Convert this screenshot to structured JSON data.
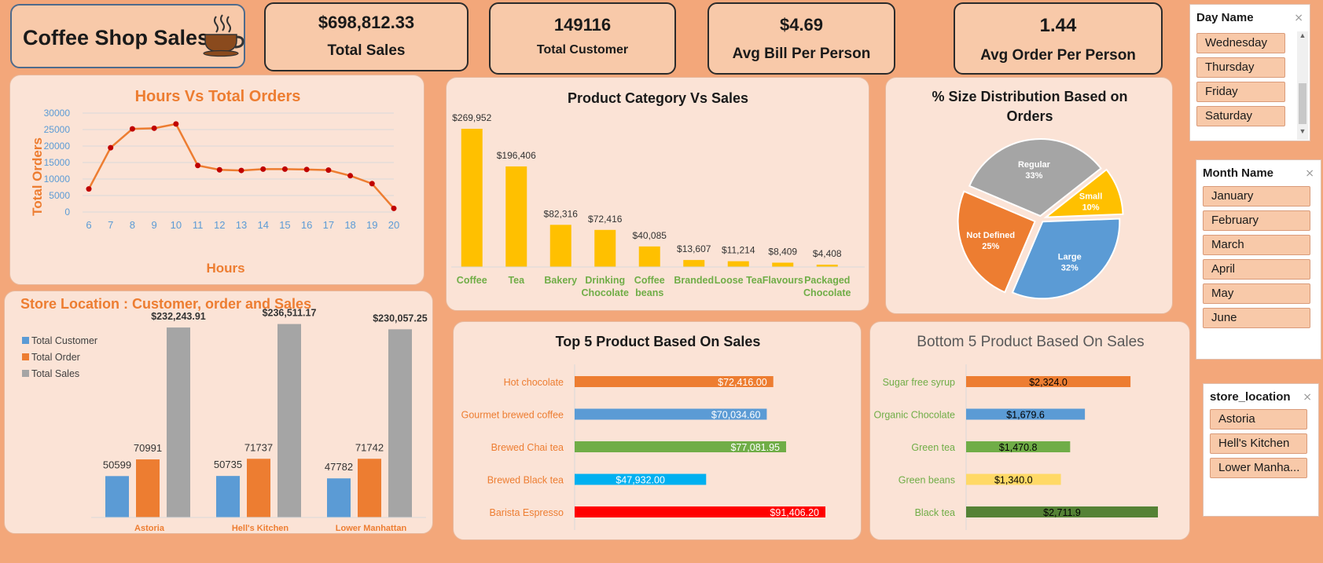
{
  "header": {
    "title": "Coffee Shop Sales",
    "icon": "coffee-cup-icon"
  },
  "kpis": {
    "total_sales": {
      "value": "$698,812.33",
      "label": "Total Sales"
    },
    "total_customer": {
      "value": "149116",
      "label": "Total Customer"
    },
    "avg_bill": {
      "value": "$4.69",
      "label": "Avg Bill Per Person"
    },
    "avg_order": {
      "value": "1.44",
      "label": "Avg Order Per Person"
    }
  },
  "slicers": {
    "day": {
      "header": "Day Name",
      "items": [
        "Wednesday",
        "Thursday",
        "Friday",
        "Saturday"
      ]
    },
    "month": {
      "header": "Month Name",
      "items": [
        "January",
        "February",
        "March",
        "April",
        "May",
        "June"
      ]
    },
    "store": {
      "header": "store_location",
      "items": [
        "Astoria",
        "Hell's Kitchen",
        "Lower Manha..."
      ]
    }
  },
  "chart_data": [
    {
      "id": "hours",
      "type": "line",
      "title": "Hours Vs Total Orders",
      "xlabel": "Hours",
      "ylabel": "Total Orders",
      "x": [
        6,
        7,
        8,
        9,
        10,
        11,
        12,
        13,
        14,
        15,
        16,
        17,
        18,
        19,
        20
      ],
      "y": [
        7000,
        19500,
        25200,
        25400,
        26700,
        14100,
        12800,
        12600,
        13000,
        13000,
        12900,
        12700,
        11000,
        8600,
        1100
      ],
      "ylim": [
        0,
        30000
      ],
      "yticks": [
        0,
        5000,
        10000,
        15000,
        20000,
        25000,
        30000
      ],
      "grid": true,
      "line_color": "#ed7d31",
      "marker_color": "#c00000"
    },
    {
      "id": "category",
      "type": "bar",
      "title": "Product Category Vs Sales",
      "categories": [
        "Coffee",
        "Tea",
        "Bakery",
        "Drinking Chocolate",
        "Coffee beans",
        "Branded",
        "Loose Tea",
        "Flavours",
        "Packaged Chocolate"
      ],
      "values": [
        269952,
        196406,
        82316,
        72416,
        40085,
        13607,
        11214,
        8409,
        4408
      ],
      "labels": [
        "$269,952",
        "$196,406",
        "$82,316",
        "$72,416",
        "$40,085",
        "$13,607",
        "$11,214",
        "$8,409",
        "$4,408"
      ],
      "color": "#ffc000"
    },
    {
      "id": "size",
      "type": "pie",
      "title": "% Size Distribution Based on Orders",
      "slices": [
        {
          "name": "Regular",
          "value": 33,
          "label": "33%",
          "color": "#a5a5a5"
        },
        {
          "name": "Small",
          "value": 10,
          "label": "10%",
          "color": "#ffc000"
        },
        {
          "name": "Large",
          "value": 32,
          "label": "32%",
          "color": "#5b9bd5"
        },
        {
          "name": "Not Defined",
          "value": 25,
          "label": "25%",
          "color": "#ed7d31"
        }
      ]
    },
    {
      "id": "store",
      "type": "bar",
      "title": "Store Location : Customer, order and Sales",
      "categories": [
        "Astoria",
        "Hell's Kitchen",
        "Lower Manhattan"
      ],
      "series": [
        {
          "name": "Total Customer",
          "values": [
            50599,
            50735,
            47782
          ],
          "labels": [
            "50599",
            "50735",
            "47782"
          ],
          "color": "#5b9bd5"
        },
        {
          "name": "Total Order",
          "values": [
            70991,
            71737,
            71742
          ],
          "labels": [
            "70991",
            "71737",
            "71742"
          ],
          "color": "#ed7d31"
        },
        {
          "name": "Total Sales",
          "values": [
            232243.91,
            236511.17,
            230057.25
          ],
          "labels": [
            "$232,243.91",
            "$236,511.17",
            "$230,057.25"
          ],
          "color": "#a5a5a5"
        }
      ],
      "legend": "left"
    },
    {
      "id": "top5",
      "type": "bar",
      "orientation": "horizontal",
      "title": "Top 5 Product Based On Sales",
      "categories": [
        "Hot chocolate",
        "Gourmet brewed coffee",
        "Brewed Chai tea",
        "Brewed Black tea",
        "Barista Espresso"
      ],
      "values": [
        72416.0,
        70034.6,
        77081.95,
        47932.0,
        91406.2
      ],
      "labels": [
        "$72,416.00",
        "$70,034.60",
        "$77,081.95",
        "$47,932.00",
        "$91,406.20"
      ],
      "colors": [
        "#ed7d31",
        "#5b9bd5",
        "#70ad47",
        "#00b0f0",
        "#ff0000"
      ]
    },
    {
      "id": "bottom5",
      "type": "bar",
      "orientation": "horizontal",
      "title": "Bottom 5 Product Based On Sales",
      "categories": [
        "Sugar free syrup",
        "Organic Chocolate",
        "Green tea",
        "Green beans",
        "Black tea"
      ],
      "values": [
        2324.0,
        1679.6,
        1470.8,
        1340.0,
        2711.9
      ],
      "labels": [
        "$2,324.0",
        "$1,679.6",
        "$1,470.8",
        "$1,340.0",
        "$2,711.9"
      ],
      "colors": [
        "#ed7d31",
        "#5b9bd5",
        "#70ad47",
        "#ffd966",
        "#548235"
      ]
    }
  ]
}
